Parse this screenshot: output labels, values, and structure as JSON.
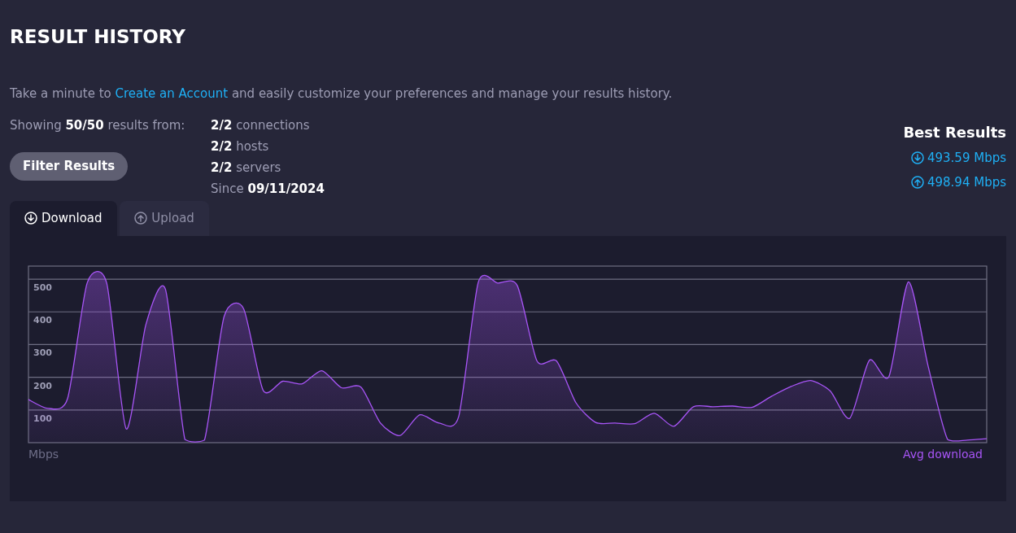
{
  "title": "RESULT HISTORY",
  "intro": {
    "before": "Take a minute to",
    "link": "Create an Account",
    "after": "and easily customize your preferences and manage your results history."
  },
  "showing": "Showing **50/50** results from:",
  "filter_button": "Filter Results",
  "stats": [
    "**2/2** connections",
    "**2/2** hosts",
    "**2/2** servers",
    "Since **09/11/2024**"
  ],
  "best_results": {
    "title": "Best Results",
    "items": [
      {
        "kind": "download",
        "value": "493.59 Mbps"
      },
      {
        "kind": "upload",
        "value": "498.94 Mbps"
      }
    ]
  },
  "tabs": [
    {
      "kind": "download",
      "label": "Download",
      "selected": true
    },
    {
      "kind": "upload",
      "label": "Upload",
      "selected": false
    }
  ],
  "chart_unit": "Mbps",
  "chart_data": {
    "type": "area",
    "grid": true,
    "ylim": [
      0,
      540
    ],
    "yticks": [
      100,
      200,
      300,
      400,
      500
    ],
    "series": [
      {
        "name": "Avg download",
        "color": "#a855f7",
        "values": [
          132,
          105,
          135,
          488,
          488,
          42,
          360,
          470,
          10,
          8,
          385,
          410,
          160,
          188,
          180,
          220,
          168,
          170,
          60,
          22,
          85,
          60,
          80,
          490,
          488,
          480,
          250,
          250,
          122,
          62,
          60,
          58,
          90,
          50,
          110,
          110,
          112,
          108,
          142,
          172,
          190,
          158,
          75,
          252,
          202,
          492,
          235,
          10,
          8,
          12
        ]
      }
    ]
  }
}
